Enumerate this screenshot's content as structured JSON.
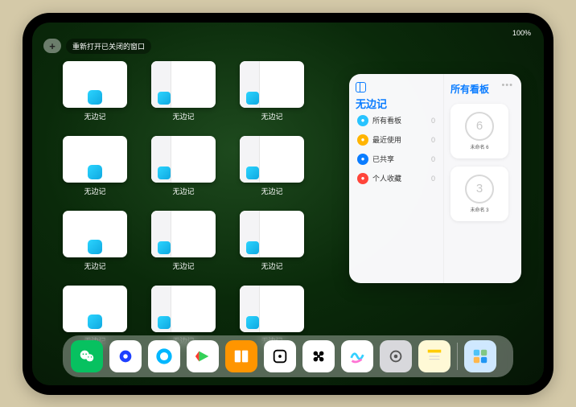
{
  "status": {
    "right": "100%"
  },
  "top": {
    "reopen_label": "重新打开已关闭的窗口",
    "plus": "+"
  },
  "windows": [
    {
      "label": "无边记",
      "kind": "blank"
    },
    {
      "label": "无边记",
      "kind": "grid sidebar"
    },
    {
      "label": "无边记",
      "kind": "grid sidebar"
    },
    {
      "label": "无边记",
      "kind": "blank"
    },
    {
      "label": "无边记",
      "kind": "grid sidebar"
    },
    {
      "label": "无边记",
      "kind": "grid sidebar"
    },
    {
      "label": "无边记",
      "kind": "blank"
    },
    {
      "label": "无边记",
      "kind": "grid sidebar"
    },
    {
      "label": "无边记",
      "kind": "grid sidebar"
    },
    {
      "label": "无边记",
      "kind": "blank"
    },
    {
      "label": "无边记",
      "kind": "grid sidebar"
    },
    {
      "label": "无边记",
      "kind": "grid sidebar"
    }
  ],
  "panel": {
    "left_title": "无边记",
    "menu": [
      {
        "icon_color": "#28c3ff",
        "label": "所有看板",
        "count": "0"
      },
      {
        "icon_color": "#ffb400",
        "label": "最近使用",
        "count": "0"
      },
      {
        "icon_color": "#0a7cff",
        "label": "已共享",
        "count": "0"
      },
      {
        "icon_color": "#ff453a",
        "label": "个人收藏",
        "count": "0"
      }
    ],
    "right_title": "所有看板",
    "boards": [
      {
        "sketch": "6",
        "caption": "未命名 6",
        "sub": ""
      },
      {
        "sketch": "3",
        "caption": "未命名 3",
        "sub": ""
      }
    ]
  },
  "dock": {
    "apps": [
      {
        "name": "wechat",
        "bg": "#07c160",
        "glyph": "wechat"
      },
      {
        "name": "browser1",
        "bg": "#ffffff",
        "glyph": "ring-blue"
      },
      {
        "name": "browser2",
        "bg": "#ffffff",
        "glyph": "ring-cyan"
      },
      {
        "name": "media",
        "bg": "#ffffff",
        "glyph": "triangle"
      },
      {
        "name": "books",
        "bg": "#ff9500",
        "glyph": "book"
      },
      {
        "name": "dice",
        "bg": "#ffffff",
        "glyph": "die"
      },
      {
        "name": "obsidian",
        "bg": "#ffffff",
        "glyph": "hex"
      },
      {
        "name": "freeform",
        "bg": "#ffffff",
        "glyph": "scribble"
      },
      {
        "name": "settings",
        "bg": "#d8d8dc",
        "glyph": "gear"
      },
      {
        "name": "notes",
        "bg": "#fff9d6",
        "glyph": "notes"
      }
    ],
    "recents": [
      {
        "name": "recents-group",
        "bg": "#cfe8ff",
        "glyph": "grid4"
      }
    ]
  }
}
